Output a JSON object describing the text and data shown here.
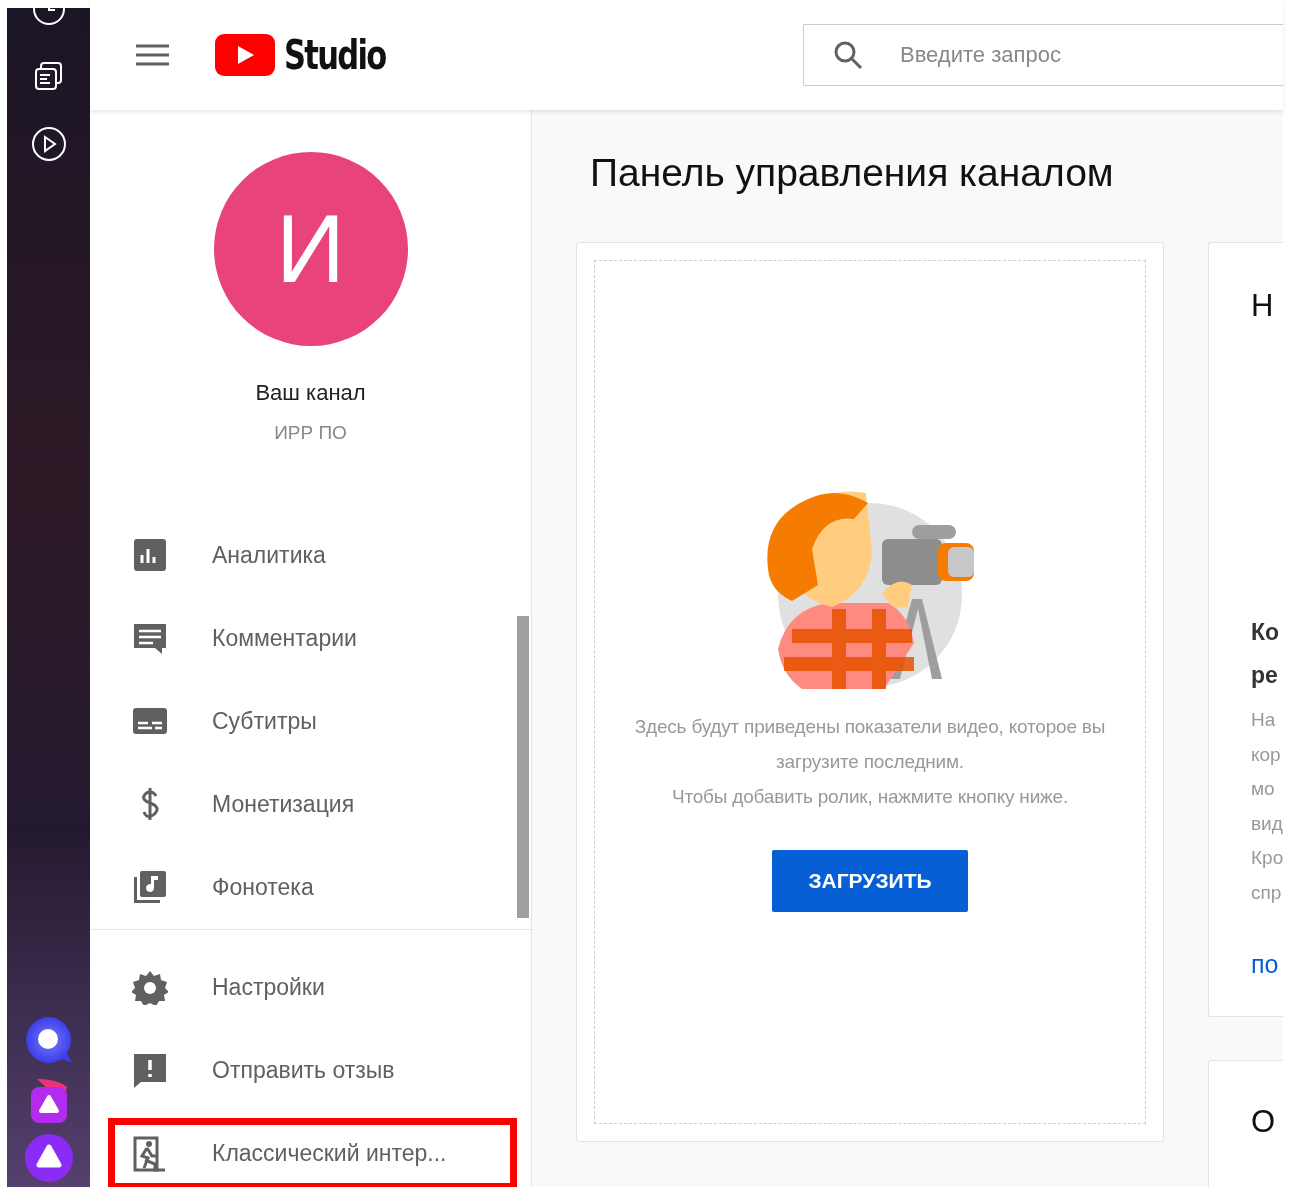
{
  "header": {
    "logo_text": "Studio",
    "search": {
      "placeholder": "Введите запрос"
    }
  },
  "channel": {
    "initial": "И",
    "title": "Ваш канал",
    "name": "ИРР ПО"
  },
  "nav_items": [
    {
      "kind": "analytics",
      "label": "Аналитика",
      "highlighted": false
    },
    {
      "kind": "comments",
      "label": "Комментарии",
      "highlighted": false
    },
    {
      "kind": "subtitles",
      "label": "Субтитры",
      "highlighted": false
    },
    {
      "kind": "money",
      "label": "Монетизация",
      "highlighted": false
    },
    {
      "kind": "library",
      "label": "Фонотека",
      "highlighted": false
    }
  ],
  "bottom_items": [
    {
      "kind": "settings",
      "label": "Настройки",
      "highlighted": false
    },
    {
      "kind": "feedback",
      "label": "Отправить отзыв",
      "highlighted": false
    },
    {
      "kind": "exit",
      "label": "Классический интер...",
      "highlighted": true
    }
  ],
  "main": {
    "title": "Панель управления каналом",
    "upload_card": {
      "lines": [
        "Здесь будут приведены показатели видео, которое вы загрузите последним.",
        "Чтобы добавить ролик, нажмите кнопку ниже."
      ],
      "button": "ЗАГРУЗИТЬ"
    },
    "news_card": {
      "title": "Н",
      "heading_lines": [
        "Ко",
        "ре"
      ],
      "body_lines": [
        "На",
        "кор",
        "мо",
        "вид",
        "Кро",
        "спр"
      ],
      "link": "по"
    },
    "third_card": {
      "title": "О"
    }
  }
}
